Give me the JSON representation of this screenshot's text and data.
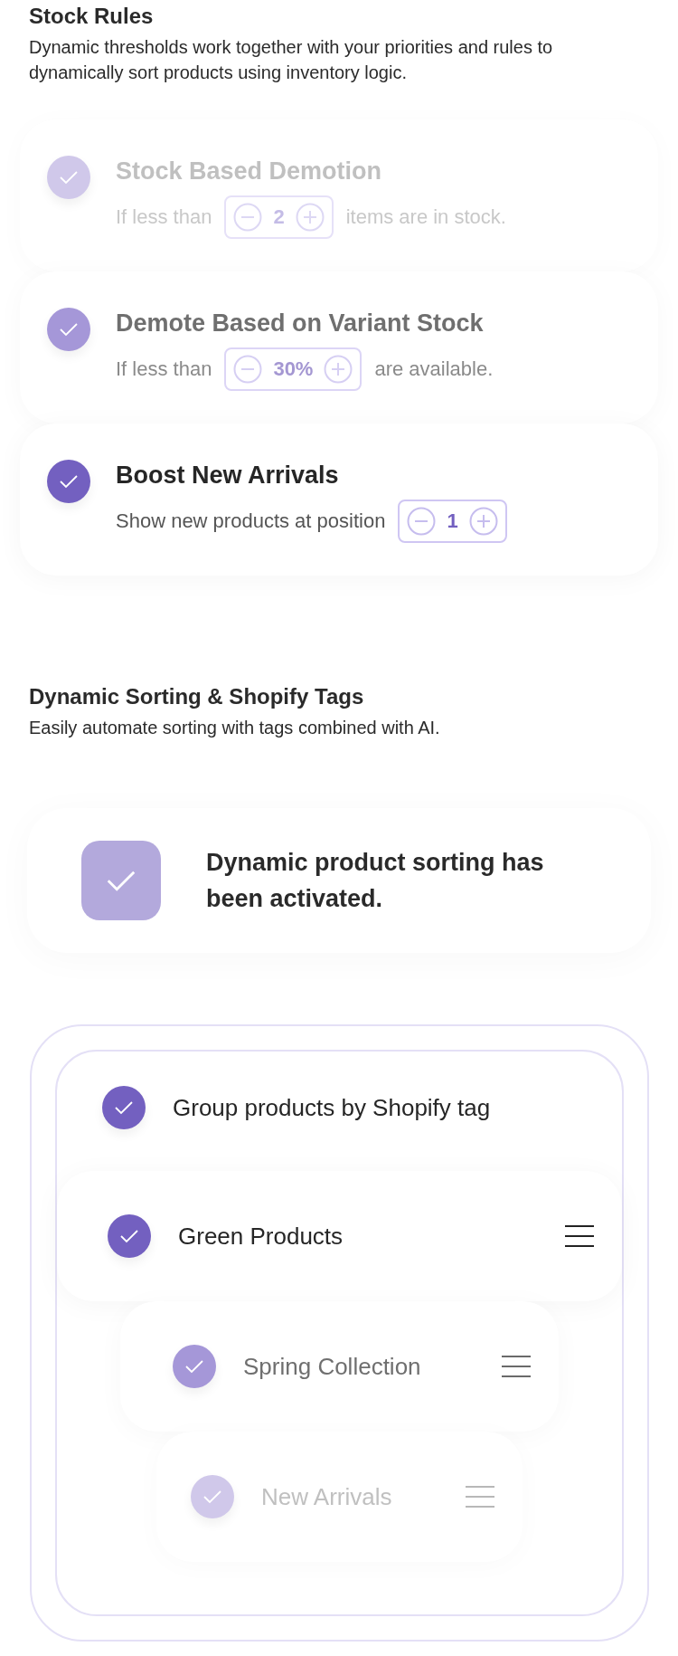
{
  "stock_rules": {
    "title": "Stock Rules",
    "description": "Dynamic thresholds work together with your priorities and rules to dynamically sort products using inventory logic.",
    "rules": [
      {
        "title": "Stock Based Demotion",
        "text_before": "If less than",
        "value": "2",
        "text_after": "items are in stock.",
        "checked": true,
        "kind": "faint"
      },
      {
        "title": "Demote Based on Variant Stock",
        "text_before": "If less than",
        "value": "30%",
        "text_after": "are available.",
        "checked": true,
        "kind": "medium"
      },
      {
        "title": "Boost New Arrivals",
        "text_before": "Show new products at position",
        "value": "1",
        "checked": true,
        "kind": "strong"
      }
    ]
  },
  "dynamic_sorting": {
    "title": "Dynamic Sorting & Shopify Tags",
    "description": "Easily automate sorting with tags combined with AI.",
    "activation": {
      "message": "Dynamic product sorting has been activated.",
      "checked": true
    },
    "group_option": {
      "label": "Group products by Shopify tag",
      "checked": true
    },
    "tags": [
      {
        "label": "Green Products",
        "checked": true,
        "kind": "strong"
      },
      {
        "label": "Spring Collection",
        "checked": true,
        "kind": "medium"
      },
      {
        "label": "New Arrivals",
        "checked": true,
        "kind": "faint"
      }
    ]
  }
}
